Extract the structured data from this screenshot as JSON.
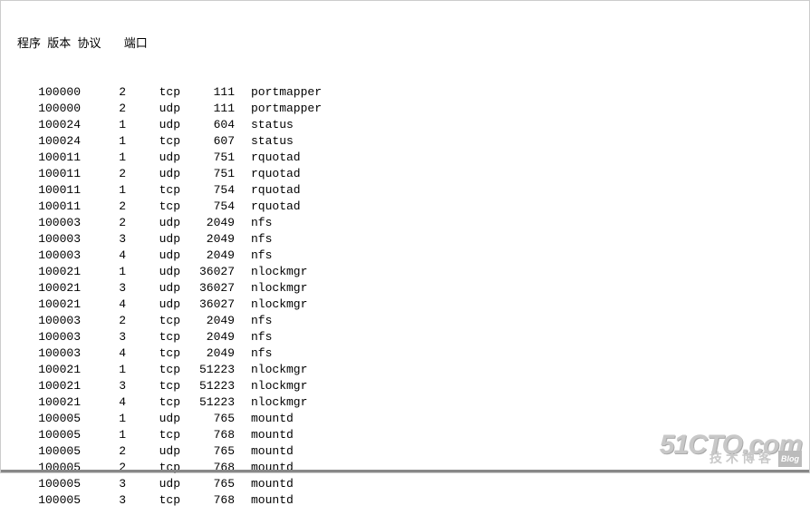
{
  "headers": {
    "program": "程序",
    "version": "版本",
    "protocol": "协议",
    "port": "端口"
  },
  "rows": [
    {
      "program": "100000",
      "version": "2",
      "protocol": "tcp",
      "port": "111",
      "name": "portmapper"
    },
    {
      "program": "100000",
      "version": "2",
      "protocol": "udp",
      "port": "111",
      "name": "portmapper"
    },
    {
      "program": "100024",
      "version": "1",
      "protocol": "udp",
      "port": "604",
      "name": "status"
    },
    {
      "program": "100024",
      "version": "1",
      "protocol": "tcp",
      "port": "607",
      "name": "status"
    },
    {
      "program": "100011",
      "version": "1",
      "protocol": "udp",
      "port": "751",
      "name": "rquotad"
    },
    {
      "program": "100011",
      "version": "2",
      "protocol": "udp",
      "port": "751",
      "name": "rquotad"
    },
    {
      "program": "100011",
      "version": "1",
      "protocol": "tcp",
      "port": "754",
      "name": "rquotad"
    },
    {
      "program": "100011",
      "version": "2",
      "protocol": "tcp",
      "port": "754",
      "name": "rquotad"
    },
    {
      "program": "100003",
      "version": "2",
      "protocol": "udp",
      "port": "2049",
      "name": "nfs"
    },
    {
      "program": "100003",
      "version": "3",
      "protocol": "udp",
      "port": "2049",
      "name": "nfs"
    },
    {
      "program": "100003",
      "version": "4",
      "protocol": "udp",
      "port": "2049",
      "name": "nfs"
    },
    {
      "program": "100021",
      "version": "1",
      "protocol": "udp",
      "port": "36027",
      "name": "nlockmgr"
    },
    {
      "program": "100021",
      "version": "3",
      "protocol": "udp",
      "port": "36027",
      "name": "nlockmgr"
    },
    {
      "program": "100021",
      "version": "4",
      "protocol": "udp",
      "port": "36027",
      "name": "nlockmgr"
    },
    {
      "program": "100003",
      "version": "2",
      "protocol": "tcp",
      "port": "2049",
      "name": "nfs"
    },
    {
      "program": "100003",
      "version": "3",
      "protocol": "tcp",
      "port": "2049",
      "name": "nfs"
    },
    {
      "program": "100003",
      "version": "4",
      "protocol": "tcp",
      "port": "2049",
      "name": "nfs"
    },
    {
      "program": "100021",
      "version": "1",
      "protocol": "tcp",
      "port": "51223",
      "name": "nlockmgr"
    },
    {
      "program": "100021",
      "version": "3",
      "protocol": "tcp",
      "port": "51223",
      "name": "nlockmgr"
    },
    {
      "program": "100021",
      "version": "4",
      "protocol": "tcp",
      "port": "51223",
      "name": "nlockmgr"
    },
    {
      "program": "100005",
      "version": "1",
      "protocol": "udp",
      "port": "765",
      "name": "mountd"
    },
    {
      "program": "100005",
      "version": "1",
      "protocol": "tcp",
      "port": "768",
      "name": "mountd"
    },
    {
      "program": "100005",
      "version": "2",
      "protocol": "udp",
      "port": "765",
      "name": "mountd"
    },
    {
      "program": "100005",
      "version": "2",
      "protocol": "tcp",
      "port": "768",
      "name": "mountd"
    },
    {
      "program": "100005",
      "version": "3",
      "protocol": "udp",
      "port": "765",
      "name": "mountd"
    },
    {
      "program": "100005",
      "version": "3",
      "protocol": "tcp",
      "port": "768",
      "name": "mountd"
    }
  ],
  "watermark": {
    "main": "51CTO.com",
    "sub": "技术博客",
    "tag": "Blog"
  }
}
